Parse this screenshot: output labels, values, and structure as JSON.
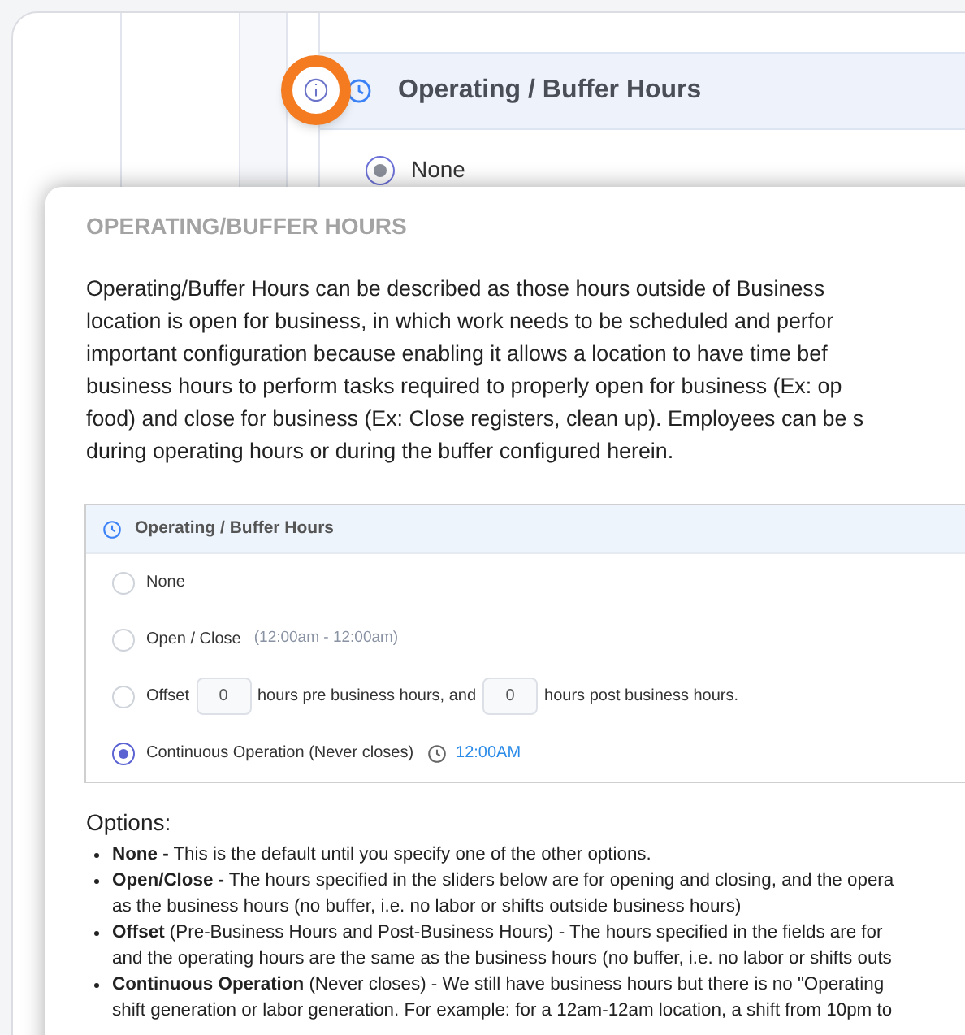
{
  "background": {
    "section_title": "Operating / Buffer Hours",
    "options": [
      {
        "label": "None",
        "selected": true
      }
    ]
  },
  "help_popup": {
    "title": "OPERATING/BUFFER HOURS",
    "paragraph_lines": [
      "Operating/Buffer Hours can be described as those hours outside of Business",
      "location is open for business, in which work needs to be scheduled and perfor",
      "important configuration because enabling it allows a location to have time bef",
      "business hours to perform tasks required to properly open for business (Ex: op",
      "food) and close for business (Ex: Close registers, clean up). Employees can be s",
      "during operating hours or during the buffer configured herein."
    ],
    "embedded_screenshot": {
      "title": "Operating / Buffer Hours",
      "options": [
        {
          "kind": "plain",
          "label": "None",
          "selected": false
        },
        {
          "kind": "range",
          "label": "Open / Close",
          "range": "(12:00am - 12:00am)",
          "selected": false
        },
        {
          "kind": "offset",
          "label": "Offset",
          "pre_value": "0",
          "pre_text": "hours pre business hours, and",
          "post_value": "0",
          "post_text": "hours post business hours.",
          "selected": false
        },
        {
          "kind": "time",
          "label": "Continuous Operation (Never closes)",
          "time": "12:00AM",
          "selected": true
        }
      ]
    },
    "options_heading": "Options:",
    "bullets": [
      {
        "lines": [
          "**None -** This is the default until you specify one of the other options."
        ]
      },
      {
        "lines": [
          "**Open/Close -** The hours specified in the sliders below are for opening and closing, and the opera",
          "as the business hours (no buffer, i.e. no labor or shifts outside business hours)"
        ]
      },
      {
        "lines": [
          "**Offset** (Pre-Business Hours and Post-Business Hours) - The hours specified in the fields are for",
          "and the operating hours are the same as the business hours (no buffer, i.e. no labor or shifts outs"
        ]
      },
      {
        "lines": [
          "**Continuous Operation** (Never closes) - We still have business hours but there is no \"Operating",
          "shift generation or labor generation. For example: for a 12am-12am location, a shift from 10pm to"
        ]
      }
    ]
  }
}
